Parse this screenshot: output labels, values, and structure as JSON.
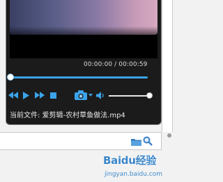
{
  "player": {
    "time_display": "00:00:00 / 00:00:59",
    "seek_progress": 0.0,
    "volume_level": 1.0,
    "current_file_label": "当前文件: 爱剪辑-农村草鱼做法.mp4"
  },
  "controls": {
    "icons": [
      "rewind-icon",
      "play-icon",
      "fast-forward-icon",
      "stop-icon",
      "camera-icon",
      "chevron-down-icon",
      "speaker-icon"
    ]
  },
  "explorer": {
    "icons": [
      "folder-icon",
      "magnifier-icon"
    ]
  },
  "watermark": {
    "main": "Baidu经验",
    "sub": "jingyan.baidu.com"
  },
  "colors": {
    "accent": "#3aa4ea",
    "panel_bg": "#1b1b1b",
    "watermark": "#3b86c9"
  }
}
